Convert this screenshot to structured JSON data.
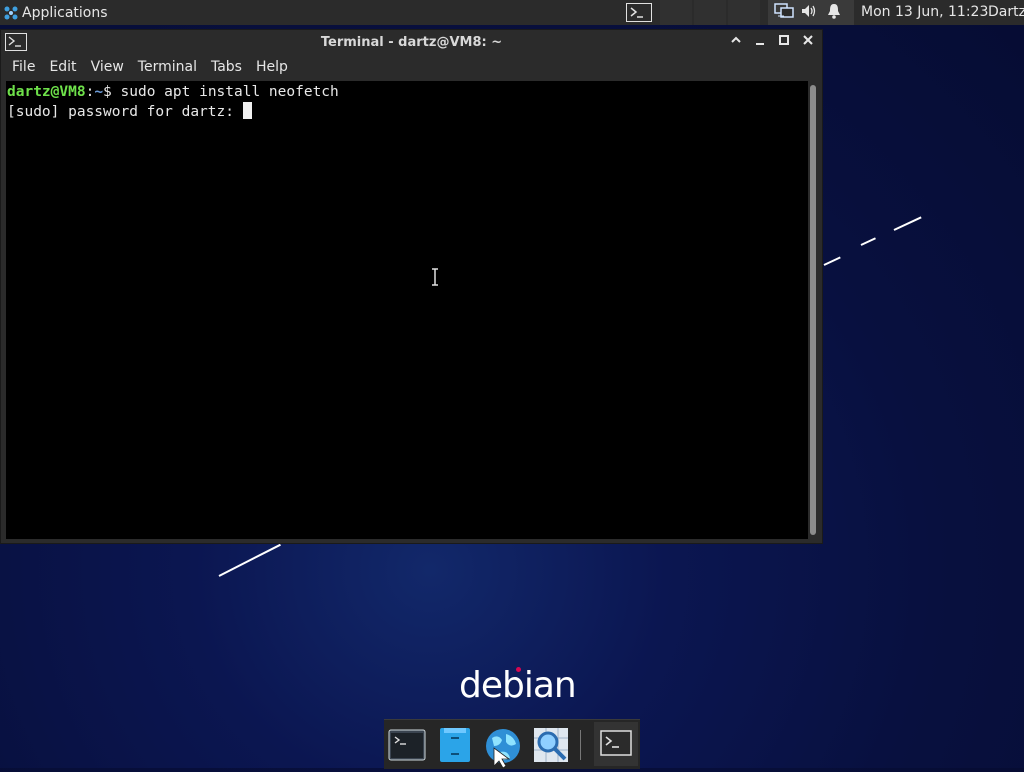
{
  "top_panel": {
    "applications_label": "Applications",
    "clock": "Mon 13 Jun, 11:23",
    "user": "Dartz"
  },
  "window": {
    "title": "Terminal - dartz@VM8: ~",
    "menus": [
      "File",
      "Edit",
      "View",
      "Terminal",
      "Tabs",
      "Help"
    ]
  },
  "terminal": {
    "prompt_user": "dartz@VM8",
    "prompt_sep": ":",
    "prompt_path": "~",
    "prompt_symbol": "$ ",
    "command": "sudo apt install neofetch",
    "line2": "[sudo] password for dartz: "
  },
  "desktop": {
    "logo_text": "debian"
  },
  "icons": {
    "apps": "applications-icon",
    "task_terminal": "terminal-icon",
    "network": "network-icon",
    "volume": "volume-icon",
    "notifications": "bell-icon"
  },
  "colors": {
    "panel": "#2b2b2b",
    "prompt_user": "#6ee14a",
    "prompt_path": "#6c9bd8",
    "desktop": "#08103f",
    "debian_red": "#d70751"
  }
}
